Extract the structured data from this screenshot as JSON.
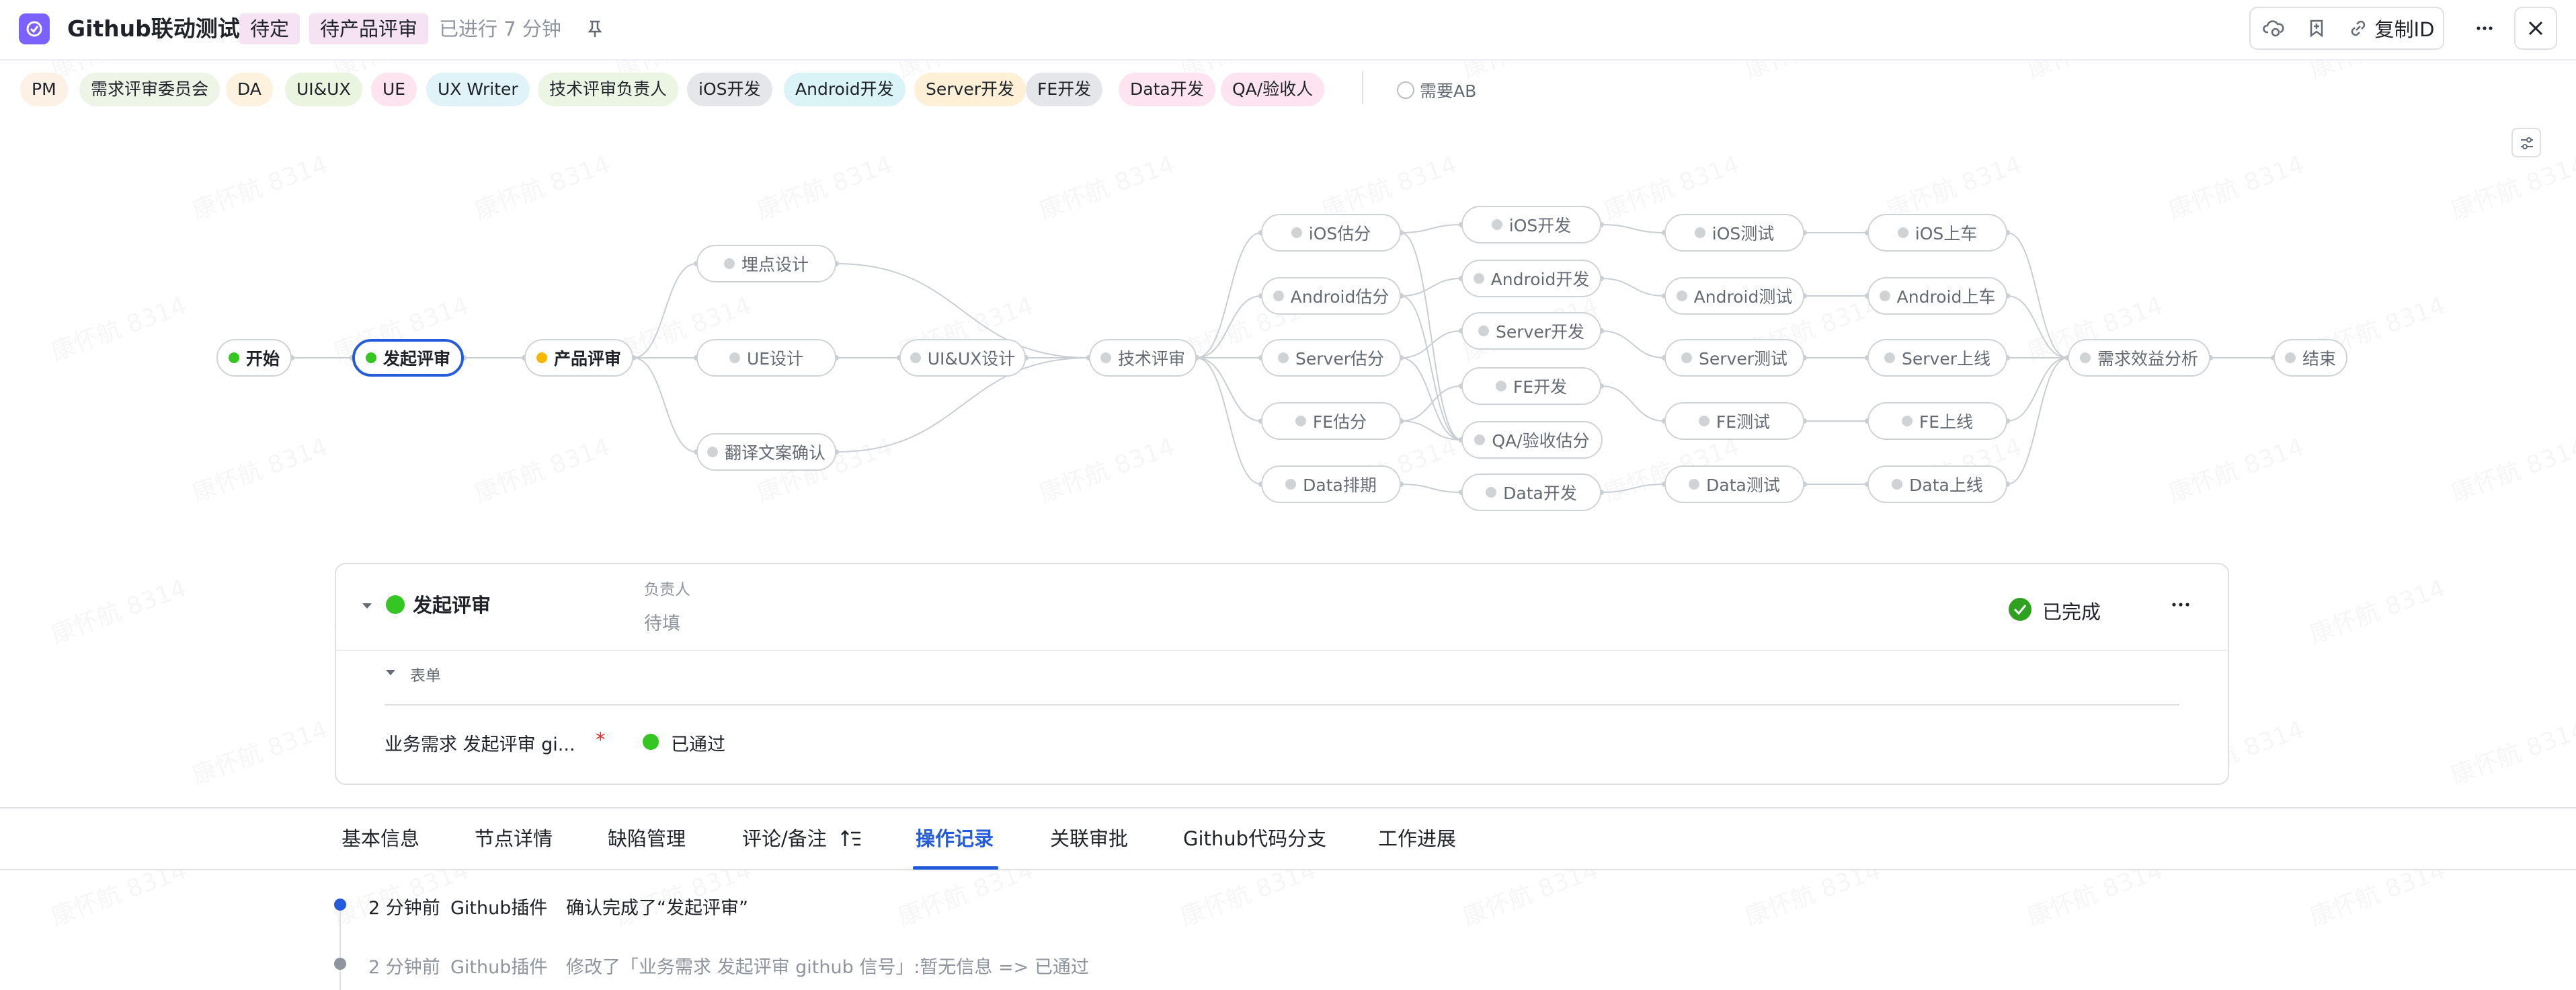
{
  "header": {
    "title": "Github联动测试",
    "status_badges": [
      "待定",
      "待产品评审"
    ],
    "elapsed": "已进行 7 分钟",
    "copy_id_label": "复制ID"
  },
  "roles": [
    {
      "label": "PM",
      "bg": "#fdf0e4"
    },
    {
      "label": "需求评审委员会",
      "bg": "#eef5e6"
    },
    {
      "label": "DA",
      "bg": "#fdf2dd"
    },
    {
      "label": "UI&UX",
      "bg": "#eaf5df"
    },
    {
      "label": "UE",
      "bg": "#fde4ee"
    },
    {
      "label": "UX Writer",
      "bg": "#dff3f8"
    },
    {
      "label": "技术评审负责人",
      "bg": "#eaf5e4"
    },
    {
      "label": "iOS开发",
      "bg": "#e4e6ea"
    },
    {
      "label": "Android开发",
      "bg": "#d9f3f7"
    },
    {
      "label": "Server开发",
      "bg": "#fdf0d7"
    },
    {
      "label": "FE开发",
      "bg": "#e4e6ea"
    },
    {
      "label": "Data开发",
      "bg": "#fde4f0"
    },
    {
      "label": "QA/验收人",
      "bg": "#fde4f0"
    }
  ],
  "need_ab_label": "需要AB",
  "flow": {
    "nodes": {
      "start": "开始",
      "initiate": "发起评审",
      "product_review": "产品评审",
      "tracking": "埋点设计",
      "ue_design": "UE设计",
      "translation": "翻译文案确认",
      "uiux": "UI&UX设计",
      "tech_review": "技术评审",
      "ios_est": "iOS估分",
      "android_est": "Android估分",
      "server_est": "Server估分",
      "fe_est": "FE估分",
      "data_sched": "Data排期",
      "ios_dev": "iOS开发",
      "android_dev": "Android开发",
      "server_dev": "Server开发",
      "fe_dev": "FE开发",
      "qa_est": "QA/验收估分",
      "data_dev": "Data开发",
      "ios_test": "iOS测试",
      "android_test": "Android测试",
      "server_test": "Server测试",
      "fe_test": "FE测试",
      "data_test": "Data测试",
      "ios_release": "iOS上车",
      "android_release": "Android上车",
      "server_release": "Server上线",
      "fe_release": "FE上线",
      "data_release": "Data上线",
      "benefit": "需求效益分析",
      "end": "结束"
    },
    "status_colors": {
      "done": "#34c724",
      "pending": "#f5b800",
      "inactive": "#d0d3d6",
      "current_border": "#245bdb"
    }
  },
  "detail": {
    "node_name": "发起评审",
    "assignee_label": "负责人",
    "assignee_value": "待填",
    "status": "已完成",
    "form_section": "表单",
    "form_field_label": "业务需求 发起评审 gi...",
    "required_mark": "*",
    "form_field_value": "已通过"
  },
  "tabs": [
    "基本信息",
    "节点详情",
    "缺陷管理",
    "评论/备注",
    "操作记录",
    "关联审批",
    "Github代码分支",
    "工作进展"
  ],
  "active_tab": "操作记录",
  "log": [
    {
      "time": "2 分钟前",
      "actor": "Github插件",
      "action": "确认完成了“发起评审”"
    },
    {
      "time": "2 分钟前",
      "actor": "Github插件",
      "action": "修改了「业务需求 发起评审 github 信号」:暂无信息 => 已通过"
    }
  ],
  "watermark": "康怀航 8314"
}
